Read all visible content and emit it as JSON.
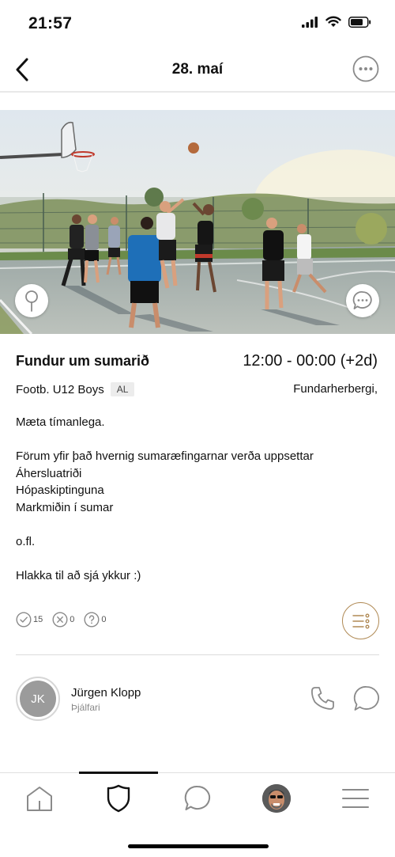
{
  "status": {
    "time": "21:57"
  },
  "nav": {
    "title": "28. maí"
  },
  "event": {
    "title": "Fundur um sumarið",
    "time": "12:00 - 00:00 (+2d)",
    "team": "Footb. U12 Boys",
    "team_badge": "AL",
    "location": "Fundarherbergi,",
    "description": [
      "Mæta tímanlega.",
      "",
      "Förum yfir það hvernig sumaræfingarnar verða uppsettar",
      "Áhersluatriði",
      "Hópaskiptinguna",
      "Markmiðin í sumar",
      "",
      "o.fl.",
      "",
      "Hlakka til að sjá ykkur :)"
    ]
  },
  "responses": {
    "accepted": "15",
    "declined": "0",
    "unknown": "0"
  },
  "contact": {
    "initials": "JK",
    "name": "Jürgen Klopp",
    "role": "Þjálfari"
  },
  "colors": {
    "accent": "#b08a55",
    "icon_gray": "#8a8a8a"
  }
}
